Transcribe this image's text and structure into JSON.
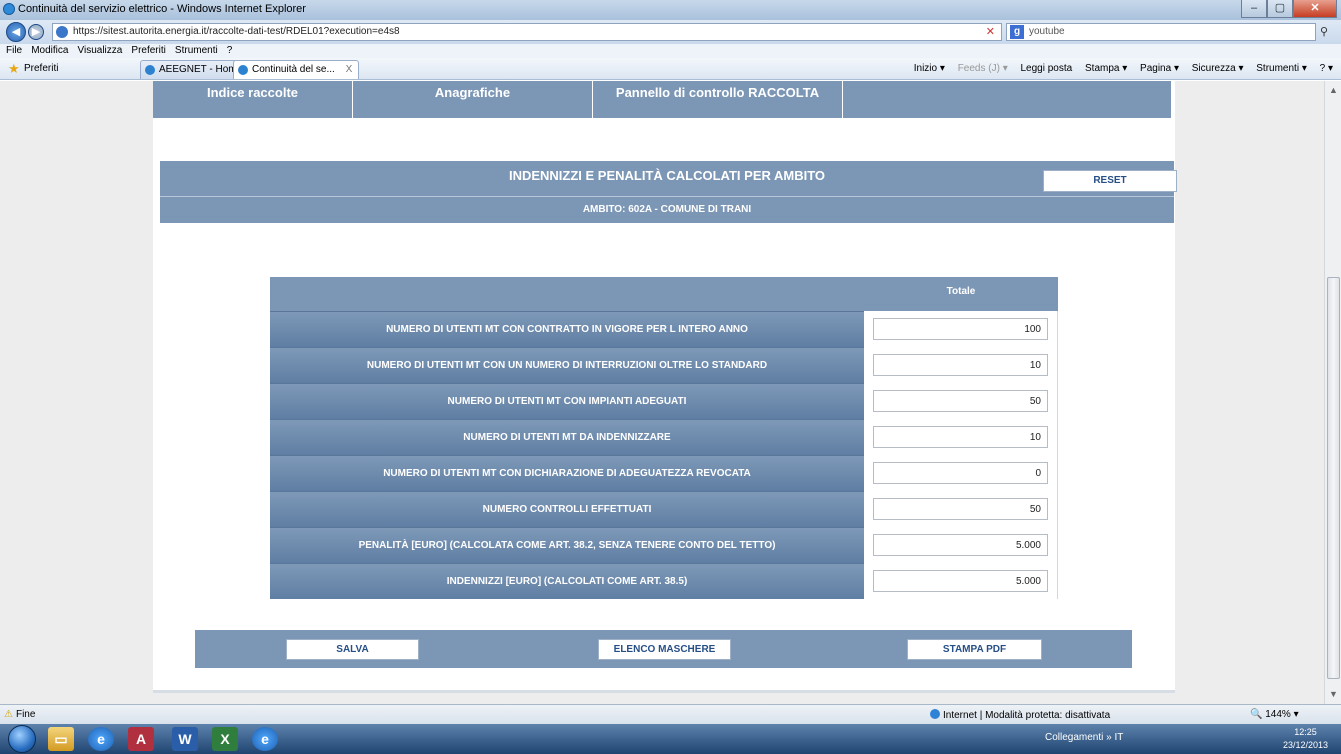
{
  "window": {
    "title": "Continuità del servizio elettrico - Windows Internet Explorer",
    "minimize": "–",
    "maximize": "▢",
    "close": "✕"
  },
  "addressbar": {
    "url": "https://sitest.autorita.energia.it/raccolte-dati-test/RDEL01?execution=e4s8",
    "search_placeholder": "youtube",
    "search_engine_label": "g"
  },
  "menubar": {
    "items": [
      "File",
      "Modifica",
      "Visualizza",
      "Preferiti",
      "Strumenti",
      "?"
    ]
  },
  "favbar": {
    "favorites_label": "Preferiti",
    "tabs": [
      {
        "label": "AEEGNET - Home P...",
        "close": ""
      },
      {
        "label": "Continuità del se...",
        "close": "X"
      }
    ],
    "tools": [
      "Inizio ▾",
      "Feeds (J) ▾",
      "Leggi posta",
      "Stampa ▾",
      "Pagina ▾",
      "Sicurezza ▾",
      "Strumenti ▾",
      "? ▾"
    ]
  },
  "nav": {
    "items": [
      "Indice raccolte",
      "Anagrafiche",
      "Pannello di controllo RACCOLTA"
    ]
  },
  "header": {
    "title": "INDENNIZZI E PENALITÀ CALCOLATI PER AMBITO",
    "subtitle": "AMBITO: 602A - COMUNE DI TRANI",
    "reset_label": "RESET"
  },
  "table": {
    "column_header": "Totale",
    "rows": [
      {
        "label": "NUMERO DI UTENTI MT CON CONTRATTO IN VIGORE PER L INTERO ANNO",
        "value": "100"
      },
      {
        "label": "NUMERO DI UTENTI MT CON UN NUMERO DI INTERRUZIONI OLTRE LO STANDARD",
        "value": "10"
      },
      {
        "label": "NUMERO DI UTENTI MT CON IMPIANTI ADEGUATI",
        "value": "50"
      },
      {
        "label": "NUMERO DI UTENTI MT DA INDENNIZZARE",
        "value": "10"
      },
      {
        "label": "NUMERO DI UTENTI MT CON DICHIARAZIONE DI ADEGUATEZZA REVOCATA",
        "value": "0"
      },
      {
        "label": "NUMERO CONTROLLI EFFETTUATI",
        "value": "50"
      },
      {
        "label": "PENALITÀ [EURO] (CALCOLATA COME ART. 38.2, SENZA TENERE CONTO DEL TETTO)",
        "value": "5.000"
      },
      {
        "label": "INDENNIZZI [EURO] (CALCOLATI COME ART. 38.5)",
        "value": "5.000"
      }
    ]
  },
  "actions": {
    "save": "SALVA",
    "masks": "ELENCO MASCHERE",
    "pdf": "STAMPA PDF"
  },
  "statusbar": {
    "left": "Fine",
    "zone": "Internet | Modalità protetta: disattivata",
    "zoom": "144%"
  },
  "taskbar": {
    "tray": "Collegamenti  »  IT",
    "time": "12:25",
    "date": "23/12/2013"
  },
  "colors": {
    "accent": "#7c97b6",
    "button_text": "#264f86"
  }
}
